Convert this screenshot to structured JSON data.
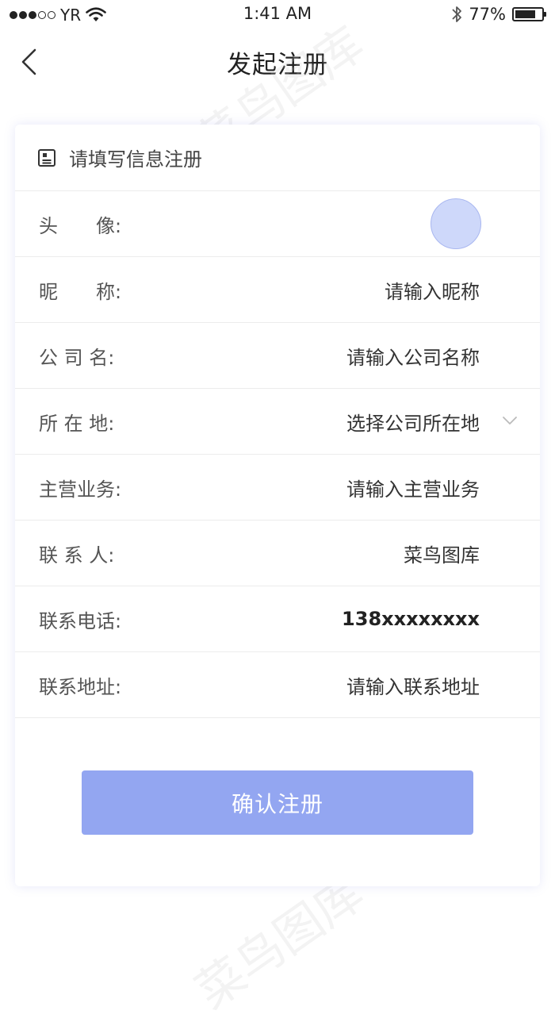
{
  "status_bar": {
    "carrier": "YR",
    "time": "1:41 AM",
    "battery_percent": "77%",
    "battery_level": 0.77,
    "signal_bars_filled": 3,
    "signal_bars_total": 5
  },
  "nav": {
    "title": "发起注册"
  },
  "card": {
    "header_text": "请填写信息注册",
    "rows": [
      {
        "label": "头　　像:",
        "value": ""
      },
      {
        "label": "昵　　称:",
        "value": "请输入昵称"
      },
      {
        "label": "公 司 名:",
        "value": "请输入公司名称"
      },
      {
        "label": "所 在 地:",
        "value": "选择公司所在地"
      },
      {
        "label": "主营业务:",
        "value": "请输入主营业务"
      },
      {
        "label": "联 系 人:",
        "value": "菜鸟图库"
      },
      {
        "label": "联系电话:",
        "value": "138xxxxxxxx"
      },
      {
        "label": "联系地址:",
        "value": "请输入联系地址"
      }
    ],
    "submit_label": "确认注册"
  },
  "watermark": "菜鸟图库",
  "colors": {
    "accent": "#93a6f1",
    "avatar_fill": "#ced8fa"
  }
}
